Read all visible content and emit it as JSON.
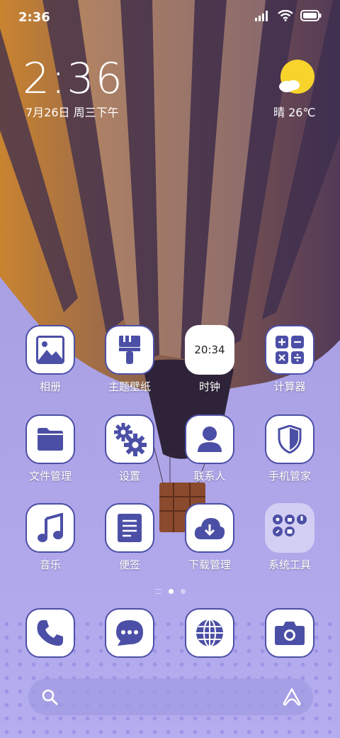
{
  "status_bar": {
    "time": "2:36",
    "icons": [
      "signal-icon",
      "wifi-icon",
      "battery-icon"
    ]
  },
  "clock_widget": {
    "time": "2:36",
    "date": "7月26日 周三下午"
  },
  "weather": {
    "text": "晴 26℃",
    "icon": "sun-cloud-icon"
  },
  "apps": [
    {
      "label": "相册",
      "icon": "gallery-icon"
    },
    {
      "label": "主题壁纸",
      "icon": "brush-icon"
    },
    {
      "label": "时钟",
      "icon": "clock-icon",
      "clock_text": "20:34"
    },
    {
      "label": "计算器",
      "icon": "calculator-icon"
    },
    {
      "label": "文件管理",
      "icon": "folder-icon"
    },
    {
      "label": "设置",
      "icon": "gears-icon"
    },
    {
      "label": "联系人",
      "icon": "contact-icon"
    },
    {
      "label": "手机管家",
      "icon": "shield-icon"
    },
    {
      "label": "音乐",
      "icon": "music-icon"
    },
    {
      "label": "便签",
      "icon": "notes-icon"
    },
    {
      "label": "下载管理",
      "icon": "download-icon"
    },
    {
      "label": "系统工具",
      "icon": "folder-group-icon"
    }
  ],
  "pages": {
    "count": 2,
    "active": 1
  },
  "dock": [
    {
      "icon": "phone-icon"
    },
    {
      "icon": "message-icon"
    },
    {
      "icon": "browser-icon"
    },
    {
      "icon": "camera-icon"
    }
  ],
  "search": {
    "icon": "search-icon",
    "assistant_icon": "assistant-icon"
  },
  "colors": {
    "icon_accent": "#4c4fa6",
    "icon_bg": "#ffffff",
    "sun": "#f8d32c"
  }
}
